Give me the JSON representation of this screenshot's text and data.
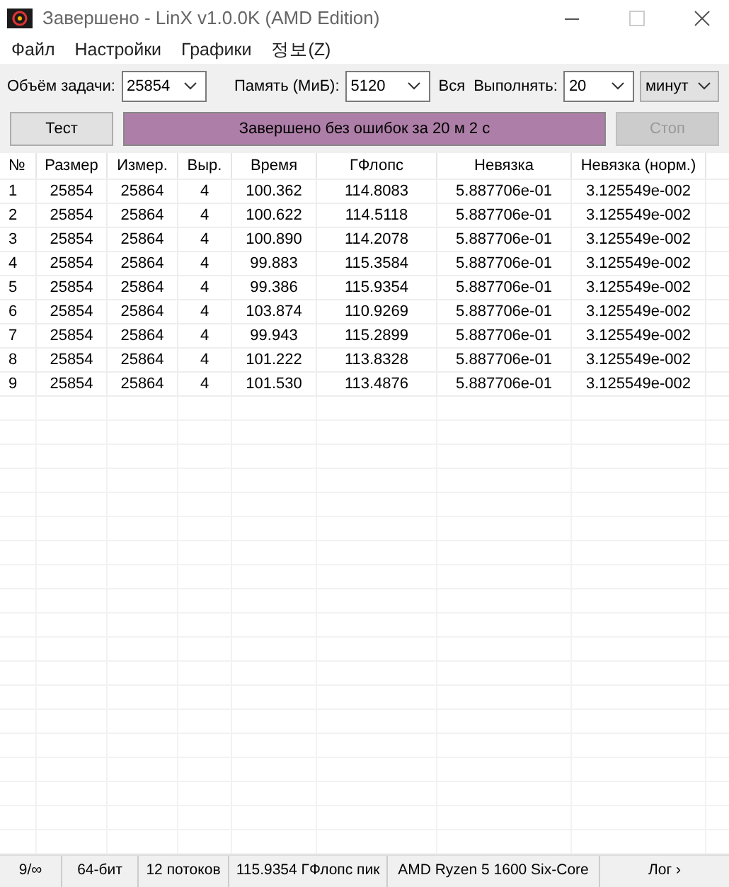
{
  "window": {
    "title": "Завершено - LinX v1.0.0K (AMD Edition)"
  },
  "menu": [
    "Файл",
    "Настройки",
    "Графики",
    "정보(Z)"
  ],
  "controls": [
    {
      "kind": "combo",
      "label": "Объём задачи:",
      "value": "25854"
    },
    {
      "kind": "combo",
      "label": "Память (МиБ):",
      "value": "5120"
    },
    {
      "kind": "text",
      "label": "Вся"
    },
    {
      "kind": "combo",
      "label": "Выполнять:",
      "value": "20"
    },
    {
      "kind": "dropdown",
      "value": "минут"
    }
  ],
  "test_button": {
    "label": "Тест",
    "disabled": false
  },
  "progress": {
    "text": "Завершено без ошибок за 20 м 2 с",
    "level": 1
  },
  "stop_button": {
    "label": "Стоп",
    "disabled": true
  },
  "table": {
    "columns": [
      "№",
      "Размер",
      "Измер.",
      "Выр.",
      "Время",
      "ГФлопс",
      "Невязка",
      "Невязка (норм.)"
    ],
    "rows": [
      [
        "1",
        "25854",
        "25864",
        "4",
        "100.362",
        "114.8083",
        "5.887706e-01",
        "3.125549e-002"
      ],
      [
        "2",
        "25854",
        "25864",
        "4",
        "100.622",
        "114.5118",
        "5.887706e-01",
        "3.125549e-002"
      ],
      [
        "3",
        "25854",
        "25864",
        "4",
        "100.890",
        "114.2078",
        "5.887706e-01",
        "3.125549e-002"
      ],
      [
        "4",
        "25854",
        "25864",
        "4",
        "99.883",
        "115.3584",
        "5.887706e-01",
        "3.125549e-002"
      ],
      [
        "5",
        "25854",
        "25864",
        "4",
        "99.386",
        "115.9354",
        "5.887706e-01",
        "3.125549e-002"
      ],
      [
        "6",
        "25854",
        "25864",
        "4",
        "103.874",
        "110.9269",
        "5.887706e-01",
        "3.125549e-002"
      ],
      [
        "7",
        "25854",
        "25864",
        "4",
        "99.943",
        "115.2899",
        "5.887706e-01",
        "3.125549e-002"
      ],
      [
        "8",
        "25854",
        "25864",
        "4",
        "101.222",
        "113.8328",
        "5.887706e-01",
        "3.125549e-002"
      ],
      [
        "9",
        "25854",
        "25864",
        "4",
        "101.530",
        "113.4876",
        "5.887706e-01",
        "3.125549e-002"
      ]
    ]
  },
  "status_bar": [
    "9/∞",
    "64-бит",
    "12 потоков",
    "115.9354 ГФлопс пик",
    "AMD Ryzen 5 1600 Six-Core",
    "Лог ›"
  ]
}
